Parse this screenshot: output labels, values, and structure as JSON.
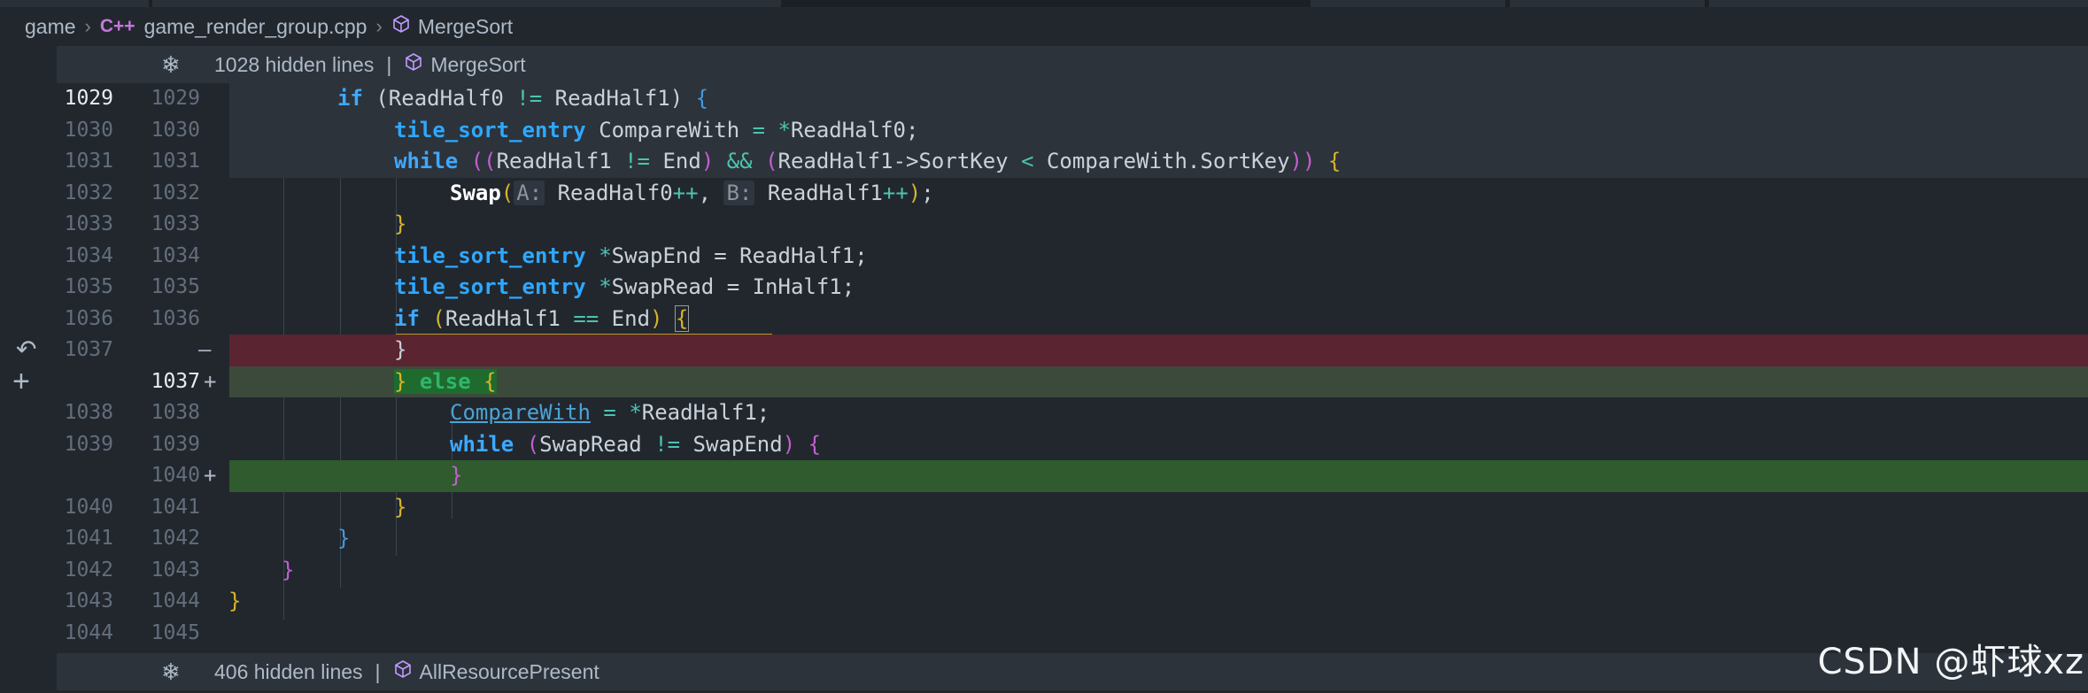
{
  "breadcrumb": {
    "folder": "game",
    "file": "game_render_group.cpp",
    "file_icon": "C++",
    "symbol": "MergeSort"
  },
  "hidden_top": {
    "count_text": "1028 hidden lines",
    "separator": "|",
    "symbol": "MergeSort"
  },
  "hidden_bottom": {
    "count_text": "406 hidden lines",
    "separator": "|",
    "symbol": "AllResourcePresent"
  },
  "watermark": "CSDN @虾球xz",
  "colors": {
    "removed_line_bg": "#5a2530",
    "added_line_bg": "#2f5b2f",
    "modified_line_bg": "#3c4a3c",
    "current_line_bg": "#2d333b",
    "keyword": "#3fa8ff"
  },
  "lines": [
    {
      "left": "1029",
      "right": "1029",
      "mark": "",
      "type": "current"
    },
    {
      "left": "1030",
      "right": "1030",
      "mark": "",
      "type": "current"
    },
    {
      "left": "1031",
      "right": "1031",
      "mark": "",
      "type": "current"
    },
    {
      "left": "1032",
      "right": "1032",
      "mark": "",
      "type": "normal"
    },
    {
      "left": "1033",
      "right": "1033",
      "mark": "",
      "type": "normal"
    },
    {
      "left": "1034",
      "right": "1034",
      "mark": "",
      "type": "normal"
    },
    {
      "left": "1035",
      "right": "1035",
      "mark": "",
      "type": "normal"
    },
    {
      "left": "1036",
      "right": "1036",
      "mark": "",
      "type": "normal"
    },
    {
      "left": "1037",
      "right": "",
      "mark": "—",
      "type": "removed"
    },
    {
      "left": "",
      "right": "1037",
      "mark": "+",
      "type": "modified"
    },
    {
      "left": "1038",
      "right": "1038",
      "mark": "",
      "type": "normal"
    },
    {
      "left": "1039",
      "right": "1039",
      "mark": "",
      "type": "normal"
    },
    {
      "left": "",
      "right": "1040",
      "mark": "+",
      "type": "added"
    },
    {
      "left": "1040",
      "right": "1041",
      "mark": "",
      "type": "normal"
    },
    {
      "left": "1041",
      "right": "1042",
      "mark": "",
      "type": "normal"
    },
    {
      "left": "1042",
      "right": "1043",
      "mark": "",
      "type": "normal"
    },
    {
      "left": "1043",
      "right": "1044",
      "mark": "",
      "type": "normal"
    },
    {
      "left": "1044",
      "right": "1045",
      "mark": "",
      "type": "normal"
    }
  ],
  "code": {
    "l1029": {
      "kw": "if",
      "t1": " (ReadHalf0 ",
      "op": "!=",
      "t2": " ReadHalf1) ",
      "brace": "{"
    },
    "l1030": {
      "ty": "tile_sort_entry",
      "t1": " CompareWith ",
      "op": "=",
      "op2": " *",
      "t2": "ReadHalf0;"
    },
    "l1031": {
      "kw": "while",
      "t1": " ",
      "p1": "((",
      "t2": "ReadHalf1 ",
      "op": "!=",
      "t3": " End",
      "p2": ")",
      "t4": " ",
      "op2": "&&",
      "t5": " ",
      "p3": "(",
      "t6": "ReadHalf1->SortKey ",
      "op3": "<",
      "t7": " CompareWith.SortKey",
      "p4": "))",
      "t8": " ",
      "brace": "{"
    },
    "l1032": {
      "fn": "Swap",
      "p1": "(",
      "hintA": "A:",
      "t1": " ReadHalf0",
      "op": "++",
      "t2": ", ",
      "hintB": "B:",
      "t3": " ReadHalf1",
      "op2": "++",
      "p2": ")",
      "t4": ";"
    },
    "l1033": {
      "brace": "}"
    },
    "l1034": {
      "ty": "tile_sort_entry",
      "t1": " ",
      "op": "*",
      "t2": "SwapEnd = ReadHalf1;"
    },
    "l1035": {
      "ty": "tile_sort_entry",
      "t1": " ",
      "op": "*",
      "t2": "SwapRead = InHalf1;"
    },
    "l1036": {
      "kw": "if",
      "t1": " ",
      "p1": "(",
      "t2": "ReadHalf1 ",
      "op": "==",
      "t3": " End",
      "p2": ")",
      "t4": " ",
      "brace": "{"
    },
    "l1037r": {
      "brace": "}"
    },
    "l1037a": {
      "brace": "}",
      "kw": " else",
      "t1": " ",
      "brace2": "{"
    },
    "l1038": {
      "und": "CompareWith",
      "t1": " ",
      "op": "=",
      "t2": " ",
      "op2": "*",
      "t3": "ReadHalf1;"
    },
    "l1039": {
      "kw": "while",
      "t1": " ",
      "p1": "(",
      "t2": "SwapRead ",
      "op": "!=",
      "t3": " SwapEnd",
      "p2": ")",
      "t4": " ",
      "brace": "{"
    },
    "l1040": {
      "brace": "}"
    },
    "l1041": {
      "brace": "}"
    },
    "l1042": {
      "brace": "}"
    },
    "l1043": {
      "brace": "}"
    },
    "l1044": {
      "brace": "}"
    }
  }
}
